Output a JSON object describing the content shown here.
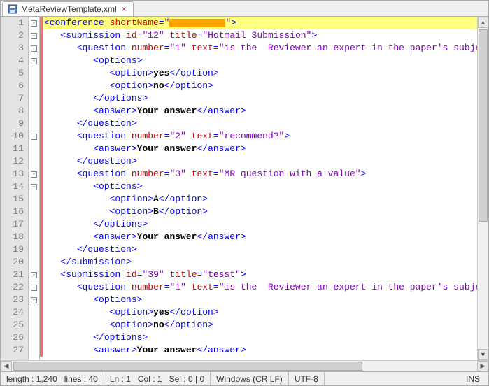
{
  "tab": {
    "title": "MetaReviewTemplate.xml",
    "icon": "save-icon",
    "close": "×"
  },
  "lines": [
    {
      "n": 1,
      "fold": "-",
      "mod": true,
      "hl": true,
      "indent": 0,
      "tokens": [
        [
          "tag",
          "<conference"
        ],
        [
          "text",
          " "
        ],
        [
          "attr",
          "shortName"
        ],
        [
          "tag",
          "="
        ],
        [
          "val",
          "\""
        ],
        [
          "redact",
          ""
        ],
        [
          "val",
          "\""
        ],
        [
          "tag",
          ">"
        ]
      ]
    },
    {
      "n": 2,
      "fold": "-",
      "mod": true,
      "indent": 1,
      "tokens": [
        [
          "tag",
          "<submission"
        ],
        [
          "text",
          " "
        ],
        [
          "attr",
          "id"
        ],
        [
          "tag",
          "="
        ],
        [
          "val",
          "\"12\""
        ],
        [
          "text",
          " "
        ],
        [
          "attr",
          "title"
        ],
        [
          "tag",
          "="
        ],
        [
          "val",
          "\"Hotmail Submission\""
        ],
        [
          "tag",
          ">"
        ]
      ]
    },
    {
      "n": 3,
      "fold": "-",
      "mod": true,
      "indent": 2,
      "tokens": [
        [
          "tag",
          "<question"
        ],
        [
          "text",
          " "
        ],
        [
          "attr",
          "number"
        ],
        [
          "tag",
          "="
        ],
        [
          "val",
          "\"1\""
        ],
        [
          "text",
          " "
        ],
        [
          "attr",
          "text"
        ],
        [
          "tag",
          "="
        ],
        [
          "val",
          "\"is the  Reviewer an expert in the paper's subject.?\""
        ],
        [
          "tag",
          ">"
        ]
      ]
    },
    {
      "n": 4,
      "fold": "-",
      "mod": true,
      "indent": 3,
      "tokens": [
        [
          "tag",
          "<options>"
        ]
      ]
    },
    {
      "n": 5,
      "fold": "",
      "mod": true,
      "indent": 4,
      "tokens": [
        [
          "tag",
          "<option>"
        ],
        [
          "text",
          "yes"
        ],
        [
          "tag",
          "</option>"
        ]
      ]
    },
    {
      "n": 6,
      "fold": "",
      "mod": true,
      "indent": 4,
      "tokens": [
        [
          "tag",
          "<option>"
        ],
        [
          "text",
          "no"
        ],
        [
          "tag",
          "</option>"
        ]
      ]
    },
    {
      "n": 7,
      "fold": "",
      "mod": true,
      "indent": 3,
      "tokens": [
        [
          "tag",
          "</options>"
        ]
      ]
    },
    {
      "n": 8,
      "fold": "",
      "mod": true,
      "indent": 3,
      "tokens": [
        [
          "tag",
          "<answer>"
        ],
        [
          "text",
          "Your answer"
        ],
        [
          "tag",
          "</answer>"
        ]
      ]
    },
    {
      "n": 9,
      "fold": "",
      "mod": true,
      "indent": 2,
      "tokens": [
        [
          "tag",
          "</question>"
        ]
      ]
    },
    {
      "n": 10,
      "fold": "-",
      "mod": true,
      "indent": 2,
      "tokens": [
        [
          "tag",
          "<question"
        ],
        [
          "text",
          " "
        ],
        [
          "attr",
          "number"
        ],
        [
          "tag",
          "="
        ],
        [
          "val",
          "\"2\""
        ],
        [
          "text",
          " "
        ],
        [
          "attr",
          "text"
        ],
        [
          "tag",
          "="
        ],
        [
          "val",
          "\"recommend?\""
        ],
        [
          "tag",
          ">"
        ]
      ]
    },
    {
      "n": 11,
      "fold": "",
      "mod": true,
      "indent": 3,
      "tokens": [
        [
          "tag",
          "<answer>"
        ],
        [
          "text",
          "Your answer"
        ],
        [
          "tag",
          "</answer>"
        ]
      ]
    },
    {
      "n": 12,
      "fold": "",
      "mod": true,
      "indent": 2,
      "tokens": [
        [
          "tag",
          "</question>"
        ]
      ]
    },
    {
      "n": 13,
      "fold": "-",
      "mod": true,
      "indent": 2,
      "tokens": [
        [
          "tag",
          "<question"
        ],
        [
          "text",
          " "
        ],
        [
          "attr",
          "number"
        ],
        [
          "tag",
          "="
        ],
        [
          "val",
          "\"3\""
        ],
        [
          "text",
          " "
        ],
        [
          "attr",
          "text"
        ],
        [
          "tag",
          "="
        ],
        [
          "val",
          "\"MR question with a value\""
        ],
        [
          "tag",
          ">"
        ]
      ]
    },
    {
      "n": 14,
      "fold": "-",
      "mod": true,
      "indent": 3,
      "tokens": [
        [
          "tag",
          "<options>"
        ]
      ]
    },
    {
      "n": 15,
      "fold": "",
      "mod": true,
      "indent": 4,
      "tokens": [
        [
          "tag",
          "<option>"
        ],
        [
          "text",
          "A"
        ],
        [
          "tag",
          "</option>"
        ]
      ]
    },
    {
      "n": 16,
      "fold": "",
      "mod": true,
      "indent": 4,
      "tokens": [
        [
          "tag",
          "<option>"
        ],
        [
          "text",
          "B"
        ],
        [
          "tag",
          "</option>"
        ]
      ]
    },
    {
      "n": 17,
      "fold": "",
      "mod": true,
      "indent": 3,
      "tokens": [
        [
          "tag",
          "</options>"
        ]
      ]
    },
    {
      "n": 18,
      "fold": "",
      "mod": true,
      "indent": 3,
      "tokens": [
        [
          "tag",
          "<answer>"
        ],
        [
          "text",
          "Your answer"
        ],
        [
          "tag",
          "</answer>"
        ]
      ]
    },
    {
      "n": 19,
      "fold": "",
      "mod": true,
      "indent": 2,
      "tokens": [
        [
          "tag",
          "</question>"
        ]
      ]
    },
    {
      "n": 20,
      "fold": "",
      "mod": true,
      "indent": 1,
      "tokens": [
        [
          "tag",
          "</submission>"
        ]
      ]
    },
    {
      "n": 21,
      "fold": "-",
      "mod": true,
      "indent": 1,
      "tokens": [
        [
          "tag",
          "<submission"
        ],
        [
          "text",
          " "
        ],
        [
          "attr",
          "id"
        ],
        [
          "tag",
          "="
        ],
        [
          "val",
          "\"39\""
        ],
        [
          "text",
          " "
        ],
        [
          "attr",
          "title"
        ],
        [
          "tag",
          "="
        ],
        [
          "val",
          "\"tesst\""
        ],
        [
          "tag",
          ">"
        ]
      ]
    },
    {
      "n": 22,
      "fold": "-",
      "mod": true,
      "indent": 2,
      "tokens": [
        [
          "tag",
          "<question"
        ],
        [
          "text",
          " "
        ],
        [
          "attr",
          "number"
        ],
        [
          "tag",
          "="
        ],
        [
          "val",
          "\"1\""
        ],
        [
          "text",
          " "
        ],
        [
          "attr",
          "text"
        ],
        [
          "tag",
          "="
        ],
        [
          "val",
          "\"is the  Reviewer an expert in the paper's subject.?\""
        ],
        [
          "tag",
          ">"
        ]
      ]
    },
    {
      "n": 23,
      "fold": "-",
      "mod": true,
      "indent": 3,
      "tokens": [
        [
          "tag",
          "<options>"
        ]
      ]
    },
    {
      "n": 24,
      "fold": "",
      "mod": true,
      "indent": 4,
      "tokens": [
        [
          "tag",
          "<option>"
        ],
        [
          "text",
          "yes"
        ],
        [
          "tag",
          "</option>"
        ]
      ]
    },
    {
      "n": 25,
      "fold": "",
      "mod": true,
      "indent": 4,
      "tokens": [
        [
          "tag",
          "<option>"
        ],
        [
          "text",
          "no"
        ],
        [
          "tag",
          "</option>"
        ]
      ]
    },
    {
      "n": 26,
      "fold": "",
      "mod": true,
      "indent": 3,
      "tokens": [
        [
          "tag",
          "</options>"
        ]
      ]
    },
    {
      "n": 27,
      "fold": "",
      "mod": true,
      "indent": 3,
      "tokens": [
        [
          "tag",
          "<answer>"
        ],
        [
          "text",
          "Your answer"
        ],
        [
          "tag",
          "</answer>"
        ]
      ]
    }
  ],
  "status": {
    "length_label": "length :",
    "length_value": "1,240",
    "lines_label": "lines :",
    "lines_value": "40",
    "ln_label": "Ln :",
    "ln_value": "1",
    "col_label": "Col :",
    "col_value": "1",
    "sel_label": "Sel :",
    "sel_value": "0 | 0",
    "eol": "Windows (CR LF)",
    "encoding": "UTF-8",
    "mode": "INS"
  }
}
